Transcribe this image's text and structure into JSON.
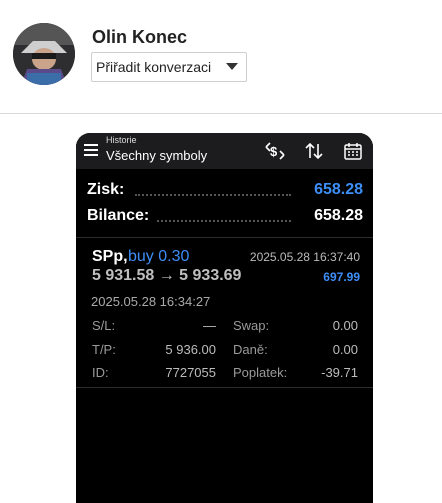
{
  "header": {
    "user_name": "Olin Konec",
    "assign_label": "Přiřadit konverzaci"
  },
  "app": {
    "subtitle": "Historie",
    "title": "Všechny symboly",
    "icons": [
      "menu-icon",
      "dollar-exchange-icon",
      "sort-icon",
      "calendar-icon"
    ]
  },
  "summary": {
    "profit_label": "Zisk:",
    "profit_value": "658.28",
    "balance_label": "Bilance:",
    "balance_value": "658.28"
  },
  "deal": {
    "symbol": "SPp,",
    "direction": "buy 0.30",
    "close_time": "2025.05.28 16:37:40",
    "prices": "5 931.58 → 5 933.69",
    "profit": "697.99",
    "open_time": "2025.05.28 16:34:27",
    "sl_label": "S/L:",
    "sl_value": "—",
    "tp_label": "T/P:",
    "tp_value": "5 936.00",
    "id_label": "ID:",
    "id_value": "7727055",
    "swap_label": "Swap:",
    "swap_value": "0.00",
    "taxes_label": "Daně:",
    "taxes_value": "0.00",
    "fee_label": "Poplatek:",
    "fee_value": "-39.71"
  },
  "colors": {
    "accent_blue": "#3d8ef7",
    "phone_bg": "#000000",
    "topbar_bg": "#1c1c1e"
  }
}
